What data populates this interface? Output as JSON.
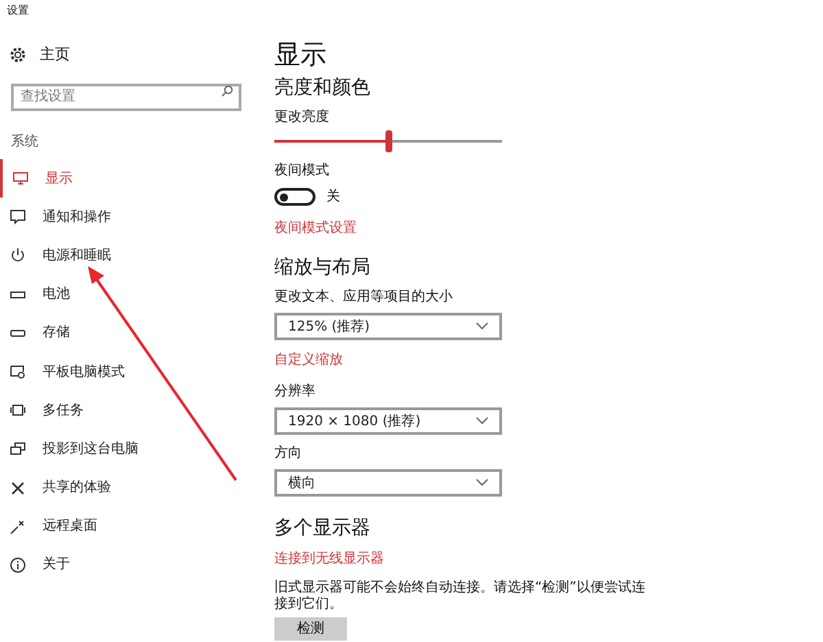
{
  "window": {
    "title": "设置"
  },
  "sidebar": {
    "home": "主页",
    "search": {
      "placeholder": "查找设置"
    },
    "section": "系统",
    "items": [
      {
        "label": "显示",
        "selected": true
      },
      {
        "label": "通知和操作",
        "selected": false
      },
      {
        "label": "电源和睡眠",
        "selected": false
      },
      {
        "label": "电池",
        "selected": false
      },
      {
        "label": "存储",
        "selected": false
      },
      {
        "label": "平板电脑模式",
        "selected": false
      },
      {
        "label": "多任务",
        "selected": false
      },
      {
        "label": "投影到这台电脑",
        "selected": false
      },
      {
        "label": "共享的体验",
        "selected": false
      },
      {
        "label": "远程桌面",
        "selected": false
      },
      {
        "label": "关于",
        "selected": false
      }
    ]
  },
  "page": {
    "title": "显示",
    "brightness": {
      "heading": "亮度和颜色",
      "label": "更改亮度",
      "level": 0.5
    },
    "night": {
      "label": "夜间模式",
      "on": false,
      "state_text": "关",
      "link": "夜间模式设置"
    },
    "scale": {
      "heading": "缩放与布局",
      "size_label": "更改文本、应用等项目的大小",
      "size_value": "125% (推荐)",
      "custom_link": "自定义缩放",
      "resolution_label": "分辨率",
      "resolution_value": "1920 × 1080 (推荐)",
      "orientation_label": "方向",
      "orientation_value": "横向"
    },
    "multi": {
      "heading": "多个显示器",
      "link": "连接到无线显示器",
      "note": "旧式显示器可能不会始终自动连接。请选择“检测”以便尝试连接到它们。",
      "button": "检测"
    }
  }
}
